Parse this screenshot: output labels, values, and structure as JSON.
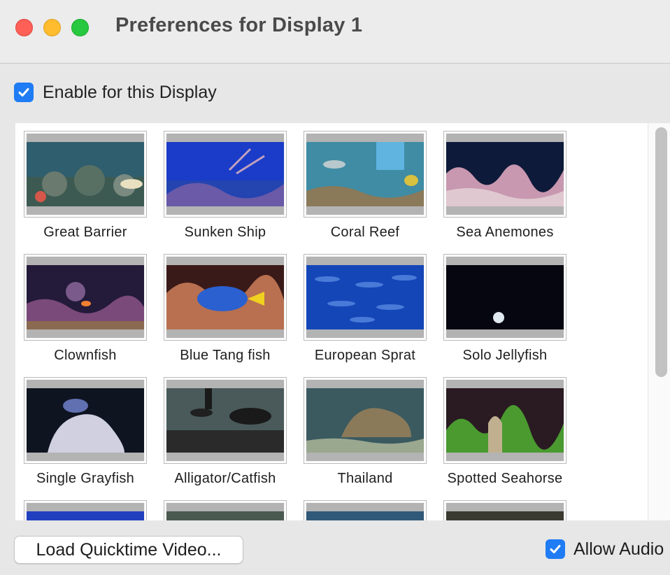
{
  "window": {
    "title": "Preferences for Display 1",
    "controls": [
      "close",
      "minimize",
      "zoom"
    ]
  },
  "enable": {
    "label": "Enable for this Display",
    "checked": true
  },
  "videos": [
    {
      "label": "Great Barrier",
      "icon": "reef-thumbnail"
    },
    {
      "label": "Sunken Ship",
      "icon": "reef-thumbnail"
    },
    {
      "label": "Coral Reef",
      "icon": "reef-thumbnail"
    },
    {
      "label": "Sea Anemones",
      "icon": "reef-thumbnail"
    },
    {
      "label": "Clownfish",
      "icon": "reef-thumbnail"
    },
    {
      "label": "Blue Tang fish",
      "icon": "reef-thumbnail"
    },
    {
      "label": "European Sprat",
      "icon": "reef-thumbnail"
    },
    {
      "label": "Solo Jellyfish",
      "icon": "reef-thumbnail"
    },
    {
      "label": "Single Grayfish",
      "icon": "reef-thumbnail"
    },
    {
      "label": "Alligator/Catfish",
      "icon": "reef-thumbnail"
    },
    {
      "label": "Thailand",
      "icon": "reef-thumbnail"
    },
    {
      "label": "Spotted Seahorse",
      "icon": "reef-thumbnail"
    },
    {
      "label": "",
      "icon": "reef-thumbnail"
    },
    {
      "label": "",
      "icon": "reef-thumbnail"
    },
    {
      "label": "",
      "icon": "reef-thumbnail"
    },
    {
      "label": "",
      "icon": "reef-thumbnail"
    }
  ],
  "bottom": {
    "load_button": "Load Quicktime Video...",
    "audio_label": "Allow Audio",
    "audio_checked": true
  },
  "colors": {
    "accent": "#1f7cf4",
    "close": "#fe5f57",
    "minimize": "#febc2e",
    "zoom": "#28c840"
  }
}
